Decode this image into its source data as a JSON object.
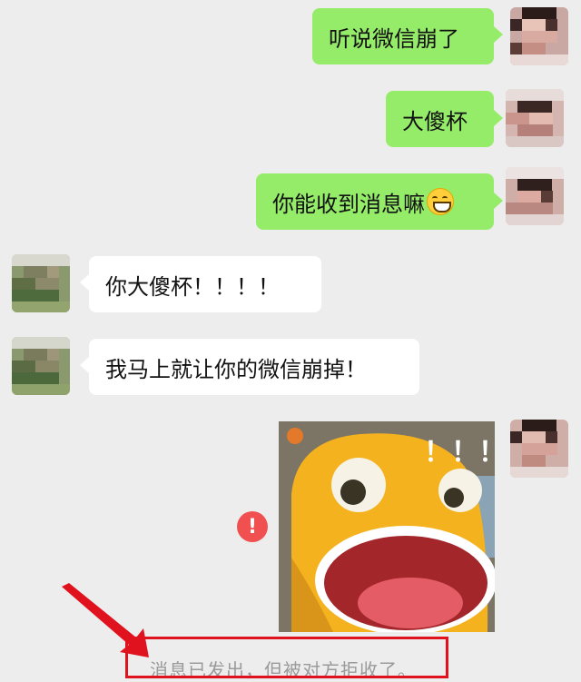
{
  "messages": [
    {
      "side": "me",
      "text": "听说微信崩了"
    },
    {
      "side": "me",
      "text": "大傻杯"
    },
    {
      "side": "me",
      "text": "你能收到消息嘛",
      "emoji": "grinning-squint-emoji"
    },
    {
      "side": "them",
      "text": "你大傻杯！！！！"
    },
    {
      "side": "them",
      "text": "我马上就让你的微信崩掉！"
    },
    {
      "side": "me",
      "type": "image",
      "overlay_text": "！！！",
      "status": "failed"
    }
  ],
  "error_badge": {
    "symbol": "!",
    "icon": "exclamation-circle-icon",
    "color": "#f05050"
  },
  "system_note": {
    "text": "消息已发出，但被对方拒收了。"
  },
  "annotation": {
    "box_color": "#e0121e",
    "arrow_color": "#e0121e"
  },
  "colors": {
    "my_bubble": "#95ec69",
    "their_bubble": "#ffffff",
    "background": "#ededed"
  }
}
